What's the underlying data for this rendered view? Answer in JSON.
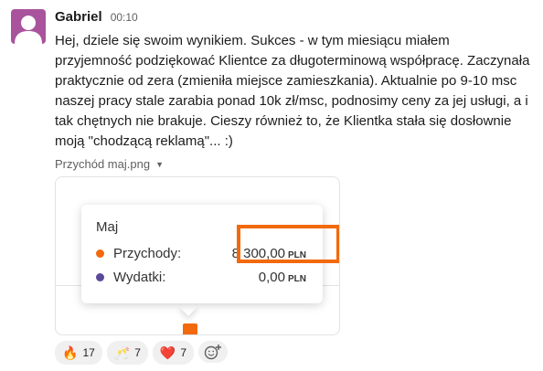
{
  "message": {
    "author": "Gabriel",
    "time": "00:10",
    "text": "Hej, dziele się swoim wynikiem. Sukces - w tym miesiącu miałem przyjemność podziękować Klientce za długoterminową współpracę. Zaczynała praktycznie od zera (zmieniła miejsce zamieszkania). Aktualnie po 9-10 msc naszej pracy stale zarabia ponad 10k zł/msc, podnosimy ceny za jej usługi, a i tak chętnych nie brakuje. Cieszy również to, że Klientka stała się dosłownie moją \"chodzącą reklamą\"... :)"
  },
  "attachment": {
    "filename": "Przychód maj.png",
    "tooltip": {
      "month": "Maj",
      "rows": [
        {
          "label": "Przychody:",
          "amount": "8 300,00",
          "unit": "PLN",
          "color": "#f26a0d"
        },
        {
          "label": "Wydatki:",
          "amount": "0,00",
          "unit": "PLN",
          "color": "#5b4a9c"
        }
      ]
    }
  },
  "reactions": [
    {
      "emoji": "🔥",
      "count": "17"
    },
    {
      "emoji": "🥂",
      "count": "7"
    },
    {
      "emoji": "❤️",
      "count": "7"
    }
  ],
  "colors": {
    "accent": "#f26a0d",
    "avatar_bg": "#a9539d"
  }
}
